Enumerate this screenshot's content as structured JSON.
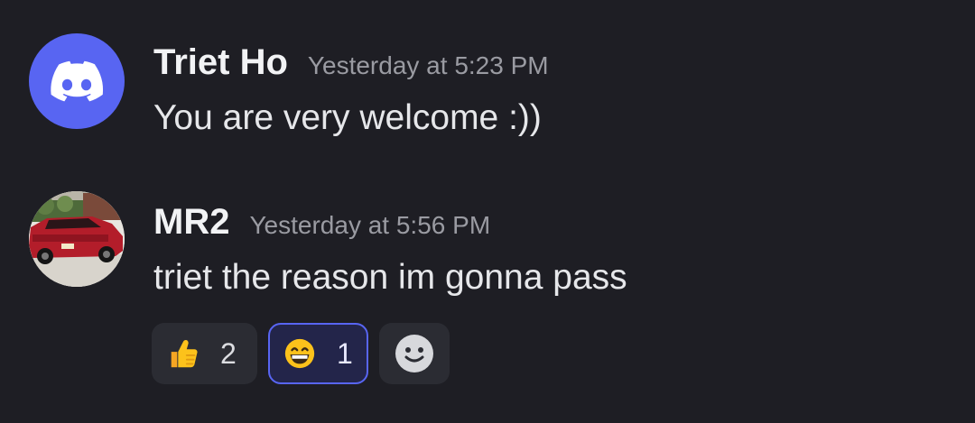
{
  "messages": [
    {
      "author": "Triet Ho",
      "timestamp": "Yesterday at 5:23 PM",
      "text": "You are very welcome :))",
      "avatar_icon": "discord-logo-icon",
      "avatar_color": "#5865f2"
    },
    {
      "author": "MR2",
      "timestamp": "Yesterday at 5:56 PM",
      "text": "triet the reason im gonna pass",
      "avatar_icon": "red-car-photo",
      "reactions": [
        {
          "emoji": "thumbs-up-icon",
          "count": "2",
          "active": false
        },
        {
          "emoji": "grinning-face-icon",
          "count": "1",
          "active": true
        }
      ],
      "add_reaction_icon": "smiley-add-reaction-icon"
    }
  ],
  "colors": {
    "background": "#1e1e24",
    "accent": "#5865f2",
    "username": "#f2f3f5",
    "timestamp": "#9a9ba2",
    "reaction_bg": "#2b2c33"
  }
}
